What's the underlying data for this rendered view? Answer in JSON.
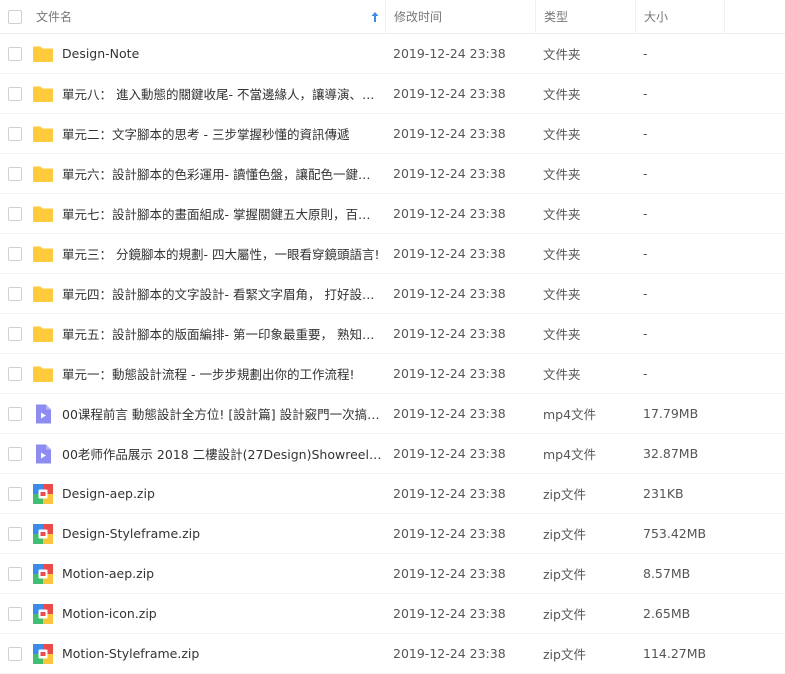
{
  "header": {
    "name": "文件名",
    "modified": "修改时间",
    "type": "类型",
    "size": "大小"
  },
  "colors": {
    "folder": "#FFCB3D",
    "video": "#8E8CF0",
    "zip_blue": "#3D8BE8",
    "zip_red": "#EC4B4B",
    "zip_green": "#3FBF6F",
    "zip_yellow": "#FBC53B",
    "sort_arrow": "#3D8BE8"
  },
  "files": [
    {
      "name": "Design-Note",
      "modified": "2019-12-24 23:38",
      "type": "文件夹",
      "size": "-",
      "icon": "folder-icon"
    },
    {
      "name": "單元八： 進入動態的關鍵收尾- 不當邊緣人，讓導演、動…",
      "modified": "2019-12-24 23:38",
      "type": "文件夹",
      "size": "-",
      "icon": "folder-icon"
    },
    {
      "name": "單元二：文字腳本的思考 - 三步掌握秒懂的資訊傳遞",
      "modified": "2019-12-24 23:38",
      "type": "文件夹",
      "size": "-",
      "icon": "folder-icon"
    },
    {
      "name": "單元六：設計腳本的色彩運用- 讀懂色盤，讓配色一鍵鍾情!",
      "modified": "2019-12-24 23:38",
      "type": "文件夹",
      "size": "-",
      "icon": "folder-icon"
    },
    {
      "name": "單元七：設計腳本的畫面組成- 掌握關鍵五大原則，百搭…",
      "modified": "2019-12-24 23:38",
      "type": "文件夹",
      "size": "-",
      "icon": "folder-icon"
    },
    {
      "name": "單元三： 分鏡腳本的規劃- 四大屬性，一眼看穿鏡頭語言!",
      "modified": "2019-12-24 23:38",
      "type": "文件夹",
      "size": "-",
      "icon": "folder-icon"
    },
    {
      "name": "單元四：設計腳本的文字設計- 看緊文字眉角， 打好設計…",
      "modified": "2019-12-24 23:38",
      "type": "文件夹",
      "size": "-",
      "icon": "folder-icon"
    },
    {
      "name": "單元五：設計腳本的版面編排- 第一印象最重要， 熟知畫…",
      "modified": "2019-12-24 23:38",
      "type": "文件夹",
      "size": "-",
      "icon": "folder-icon"
    },
    {
      "name": "單元一：動態設計流程 - 一步步規劃出你的工作流程!",
      "modified": "2019-12-24 23:38",
      "type": "文件夹",
      "size": "-",
      "icon": "folder-icon"
    },
    {
      "name": "00课程前言 動態設計全方位! [設計篇] 設計竅門一次搞…",
      "modified": "2019-12-24 23:38",
      "type": "mp4文件",
      "size": "17.79MB",
      "icon": "video-icon"
    },
    {
      "name": "00老师作品展示 2018 二樓設計(27Design)Showreel.m…",
      "modified": "2019-12-24 23:38",
      "type": "mp4文件",
      "size": "32.87MB",
      "icon": "video-icon"
    },
    {
      "name": "Design-aep.zip",
      "modified": "2019-12-24 23:38",
      "type": "zip文件",
      "size": "231KB",
      "icon": "zip-icon"
    },
    {
      "name": "Design-Styleframe.zip",
      "modified": "2019-12-24 23:38",
      "type": "zip文件",
      "size": "753.42MB",
      "icon": "zip-icon"
    },
    {
      "name": "Motion-aep.zip",
      "modified": "2019-12-24 23:38",
      "type": "zip文件",
      "size": "8.57MB",
      "icon": "zip-icon"
    },
    {
      "name": "Motion-icon.zip",
      "modified": "2019-12-24 23:38",
      "type": "zip文件",
      "size": "2.65MB",
      "icon": "zip-icon"
    },
    {
      "name": "Motion-Styleframe.zip",
      "modified": "2019-12-24 23:38",
      "type": "zip文件",
      "size": "114.27MB",
      "icon": "zip-icon"
    }
  ]
}
